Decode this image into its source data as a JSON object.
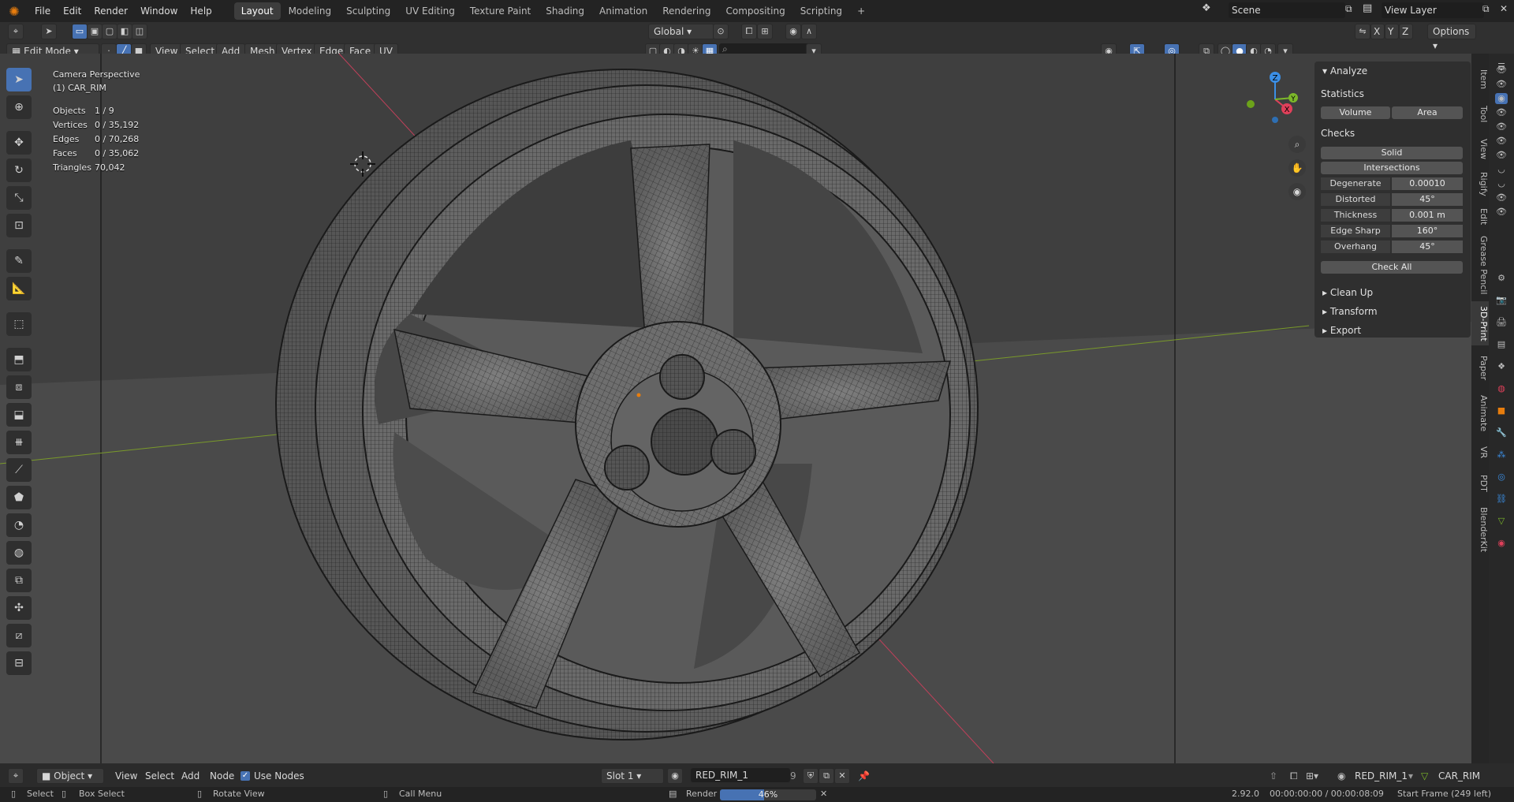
{
  "topbar": {
    "menus": [
      "File",
      "Edit",
      "Render",
      "Window",
      "Help"
    ],
    "workspaces": [
      "Layout",
      "Modeling",
      "Sculpting",
      "UV Editing",
      "Texture Paint",
      "Shading",
      "Animation",
      "Rendering",
      "Compositing",
      "Scripting"
    ],
    "active_workspace": "Layout",
    "add_tab": "+",
    "scene": "Scene",
    "view_layer": "View Layer"
  },
  "header": {
    "mode": "Edit Mode",
    "menus": [
      "View",
      "Select",
      "Add",
      "Mesh",
      "Vertex",
      "Edge",
      "Face",
      "UV"
    ],
    "transform_orientation": "Global",
    "axes": [
      "X",
      "Y",
      "Z"
    ],
    "options": "Options"
  },
  "overlay": {
    "view_name": "Camera Perspective",
    "object_name": "(1) CAR_RIM",
    "stats": [
      {
        "label": "Objects",
        "value": "1 / 9"
      },
      {
        "label": "Vertices",
        "value": "0 / 35,192"
      },
      {
        "label": "Edges",
        "value": "0 / 70,268"
      },
      {
        "label": "Faces",
        "value": "0 / 35,062"
      },
      {
        "label": "Triangles",
        "value": "70,042"
      }
    ]
  },
  "gizmo": {
    "x": "X",
    "y": "Y",
    "z": "Z"
  },
  "npanel": {
    "analyze": "Analyze",
    "statistics": "Statistics",
    "volume": "Volume",
    "area": "Area",
    "checks": "Checks",
    "solid": "Solid",
    "intersections": "Intersections",
    "rows": [
      {
        "label": "Degenerate",
        "value": "0.00010"
      },
      {
        "label": "Distorted",
        "value": "45°"
      },
      {
        "label": "Thickness",
        "value": "0.001 m"
      },
      {
        "label": "Edge Sharp",
        "value": "160°"
      },
      {
        "label": "Overhang",
        "value": "45°"
      }
    ],
    "check_all": "Check All",
    "sections": [
      "Clean Up",
      "Transform",
      "Export"
    ]
  },
  "sidetabs": [
    "Item",
    "Tool",
    "View",
    "Rigify",
    "Edit",
    "Grease Pencil",
    "3D-Print",
    "Paper",
    "Animate",
    "VR",
    "PDT",
    "BlenderKit"
  ],
  "active_sidetab": "3D-Print",
  "bottom": {
    "editor": "Object",
    "menus": [
      "View",
      "Select",
      "Add",
      "Node"
    ],
    "use_nodes": "Use Nodes",
    "slot": "Slot 1",
    "material": "RED_RIM_1",
    "users": "9",
    "material_right": "RED_RIM_1",
    "object_right": "CAR_RIM"
  },
  "status": {
    "select": "Select",
    "box_select": "Box Select",
    "rotate_view": "Rotate View",
    "call_menu": "Call Menu",
    "render": "Render",
    "progress_label": "46%",
    "progress": 0.46,
    "version": "2.92.0",
    "timecode": "00:00:00:00 / 00:00:08:09",
    "start_frame": "Start Frame (249 left)"
  },
  "colors": {
    "accent": "#4772b3",
    "x_axis": "#e0405a",
    "y_axis": "#7cb82a",
    "z_axis": "#3b8fe6",
    "blender_orange": "#e87d0d"
  }
}
